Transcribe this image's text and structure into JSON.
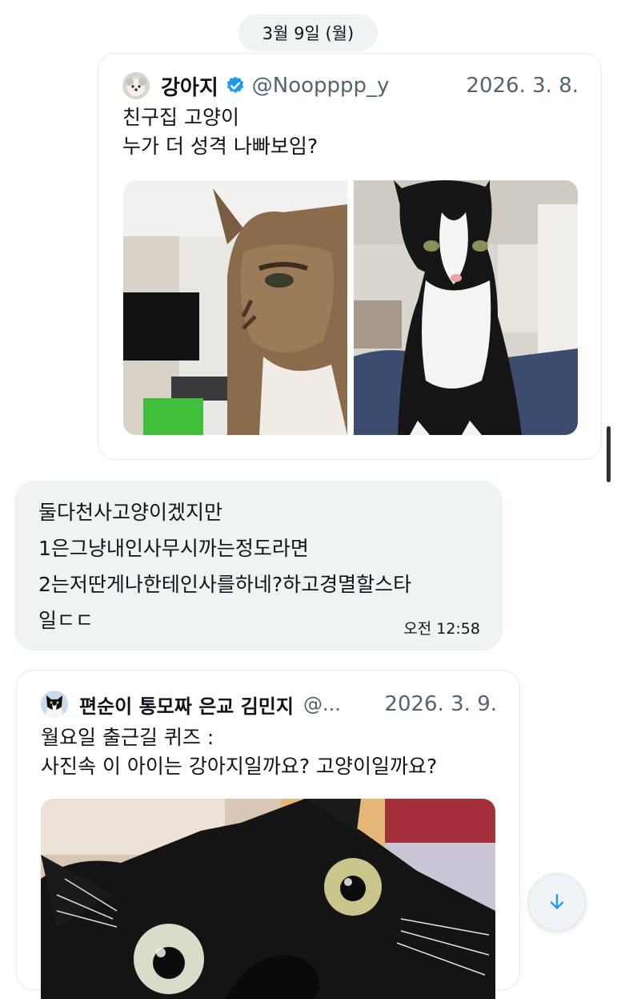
{
  "date_separator": "3월 9일 (월)",
  "quote1": {
    "author_name": "강아지",
    "handle": "@Noopppp_y",
    "date": "2026. 3. 8.",
    "text_lines": [
      "친구집 고양이",
      "누가 더 성격 나빠보임?"
    ],
    "avatar_icon": "dog-avatar",
    "verified_icon": "verified-badge-icon",
    "verified_color": "#1d9bf0"
  },
  "message": {
    "lines": [
      "둘다천사고양이겠지만",
      "1은그냥내인사무시까는정도라면",
      "2는저딴게나한테인사를하네?하고경멸할스타",
      "일ㄷㄷ"
    ],
    "time": "오전 12:58"
  },
  "quote2": {
    "author_name": "편순이 통모짜 은교 김민지",
    "handle": "@...",
    "date": "2026. 3. 9.",
    "text_lines": [
      "월요일 출근길 퀴즈 :",
      "사진속 이 아이는 강아지일까요? 고양이일까요?"
    ],
    "avatar_icon": "cat-avatar"
  },
  "scroll_down_icon": "arrow-down-icon",
  "accent_color": "#1d9bf0"
}
